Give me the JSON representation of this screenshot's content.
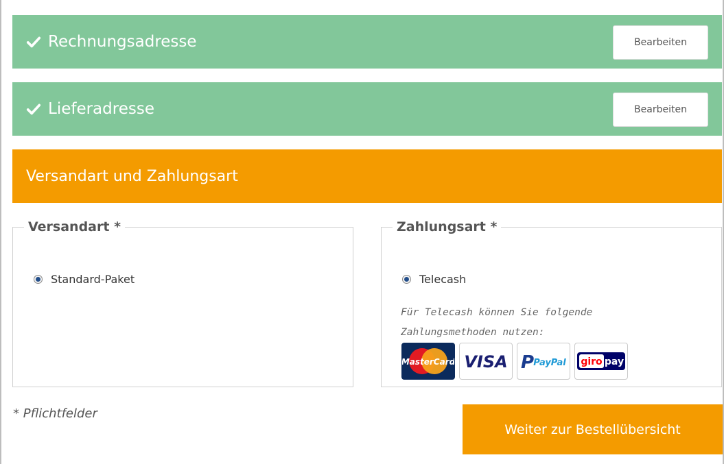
{
  "steps": {
    "billing": {
      "title": "Rechnungsadresse",
      "edit_label": "Bearbeiten"
    },
    "shipping_address": {
      "title": "Lieferadresse",
      "edit_label": "Bearbeiten"
    },
    "current": {
      "title": "Versandart und Zahlungsart"
    }
  },
  "shipping_method": {
    "legend": "Versandart *",
    "options": [
      {
        "label": "Standard-Paket",
        "selected": true
      }
    ]
  },
  "payment_method": {
    "legend": "Zahlungsart *",
    "options": [
      {
        "label": "Telecash",
        "selected": true
      }
    ],
    "description_line1": "Für Telecash können Sie folgende",
    "description_line2": "Zahlungsmethoden nutzen:",
    "logos": [
      {
        "name": "mastercard-logo",
        "text": "MasterCard"
      },
      {
        "name": "visa-logo",
        "text": "VISA"
      },
      {
        "name": "paypal-logo",
        "text": "PayPal"
      },
      {
        "name": "giropay-logo",
        "text_left": "giro",
        "text_right": "pay"
      }
    ]
  },
  "footer": {
    "required_note": "* Pflichtfelder",
    "continue_label": "Weiter zur Bestellübersicht"
  },
  "colors": {
    "completed_step": "#82c79a",
    "active_step": "#f49b00",
    "primary_button": "#f49b00"
  }
}
